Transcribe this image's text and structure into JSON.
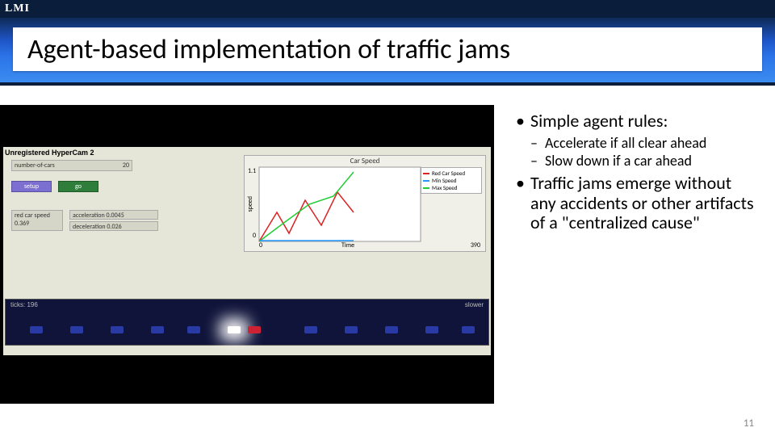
{
  "brand": "LMI",
  "title": "Agent-based implementation of traffic jams",
  "page_number": "11",
  "bullets": [
    {
      "text": "Simple agent rules:",
      "sub": [
        "Accelerate if all clear ahead",
        "Slow down if a car ahead"
      ]
    },
    {
      "text": "Traffic jams emerge without any accidents or other artifacts of a   \"centralized cause\"",
      "sub": []
    }
  ],
  "media": {
    "watermark": "Unregistered HyperCam 2",
    "controls": {
      "num_cars_label": "number-of-cars",
      "num_cars_value": "20",
      "setup_label": "setup",
      "go_label": "go",
      "red_speed_label": "red car speed",
      "red_speed_value": "0.369",
      "accel_label": "acceleration 0.0045",
      "decel_label": "deceleration  0.026"
    },
    "chart": {
      "title": "Car Speed",
      "ylabel": "speed",
      "xlabel": "Time",
      "y_top": "1.1",
      "y_bot": "0",
      "x_left": "0",
      "x_right": "390",
      "legend": [
        {
          "color": "#d22",
          "label": "Red Car Speed"
        },
        {
          "color": "#29f",
          "label": "Min Speed"
        },
        {
          "color": "#2c3",
          "label": "Max Speed"
        }
      ]
    },
    "strip": {
      "left_label": "ticks: 196",
      "right_label": "slower"
    }
  },
  "chart_data": {
    "type": "line",
    "title": "Car Speed",
    "xlabel": "Time",
    "ylabel": "speed",
    "xlim": [
      0,
      390
    ],
    "ylim": [
      0,
      1.1
    ],
    "x": [
      0,
      30,
      60,
      90,
      120,
      150,
      196
    ],
    "series": [
      {
        "name": "Red Car Speed",
        "color": "#d22",
        "values": [
          0.0,
          0.35,
          0.1,
          0.5,
          0.2,
          0.6,
          0.37
        ]
      },
      {
        "name": "Min Speed",
        "color": "#29f",
        "values": [
          0.0,
          0.0,
          0.0,
          0.0,
          0.0,
          0.0,
          0.0
        ]
      },
      {
        "name": "Max Speed",
        "color": "#2c3",
        "values": [
          0.0,
          0.25,
          0.45,
          0.55,
          0.75,
          0.9,
          1.0
        ]
      }
    ]
  }
}
